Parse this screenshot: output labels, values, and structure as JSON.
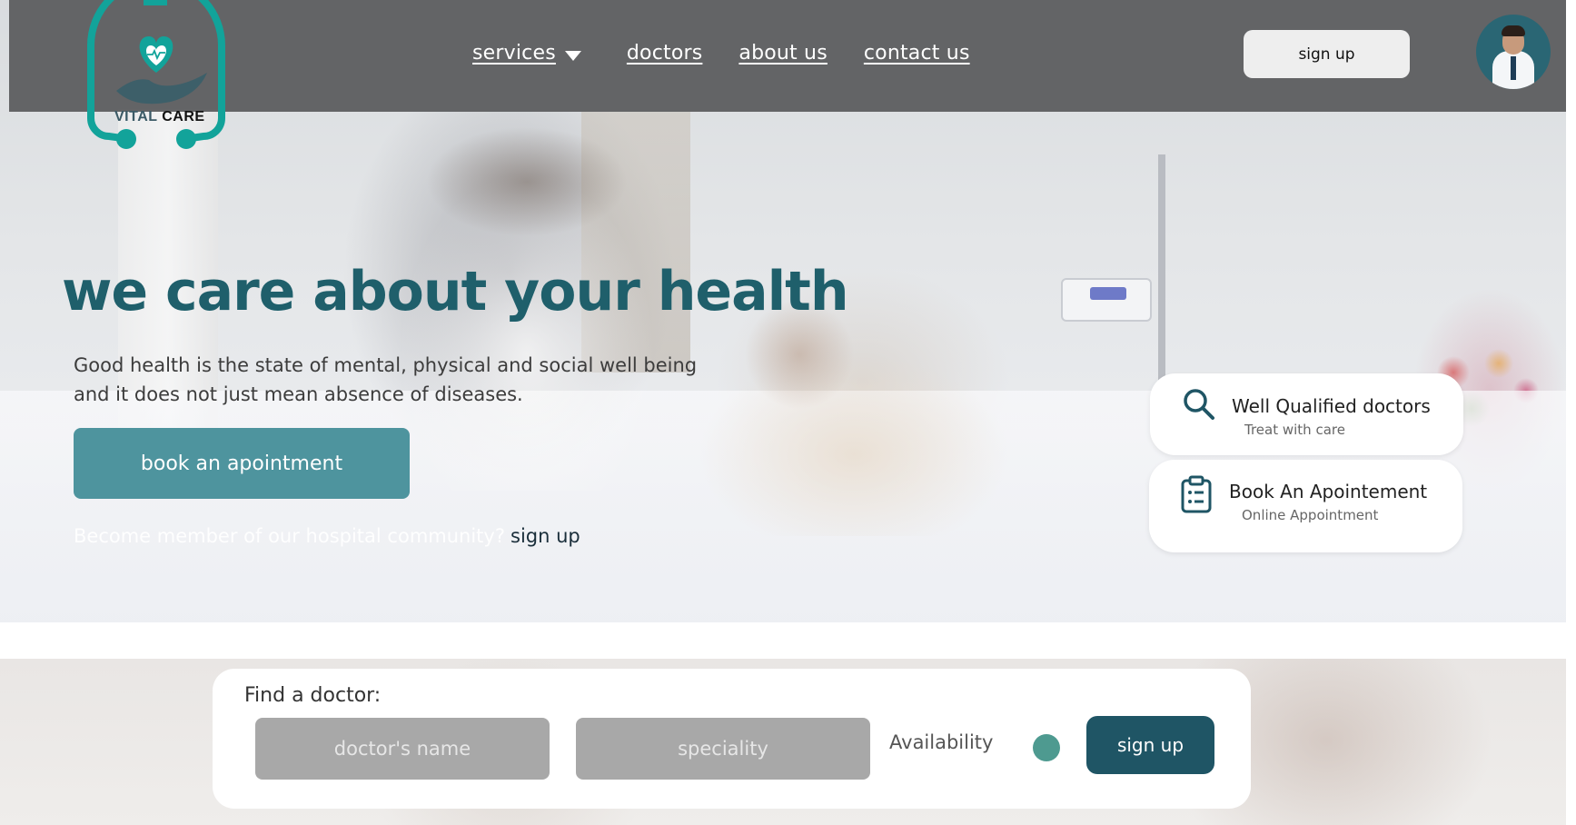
{
  "brand": {
    "name_part1": "VITAL",
    "name_part2": "CARE",
    "primary_color": "#1f5f6b",
    "accent_color": "#12a39a"
  },
  "nav": {
    "items": [
      {
        "label": "services",
        "has_dropdown": true
      },
      {
        "label": "doctors"
      },
      {
        "label": "about us"
      },
      {
        "label": "contact us"
      }
    ],
    "signup_label": "sign up",
    "avatar_icon": "doctor-avatar"
  },
  "hero": {
    "title": "we care about your health",
    "description_line1": "Good health is the state of mental, physical and social well being",
    "description_line2": "and it does not just mean absence of diseases.",
    "cta_label": "book an apointment",
    "member_text": "Become member of our hospital community?",
    "member_link": "sign up"
  },
  "features": [
    {
      "icon": "search-icon",
      "title": "Well Qualified doctors",
      "subtitle": "Treat with care"
    },
    {
      "icon": "clipboard-icon",
      "title": "Book An Apointement",
      "subtitle": "Online Appointment"
    }
  ],
  "find_doctor": {
    "label": "Find a doctor:",
    "name_placeholder": "doctor's name",
    "speciality_placeholder": "speciality",
    "availability_label": "Availability",
    "button_label": "sign up"
  }
}
